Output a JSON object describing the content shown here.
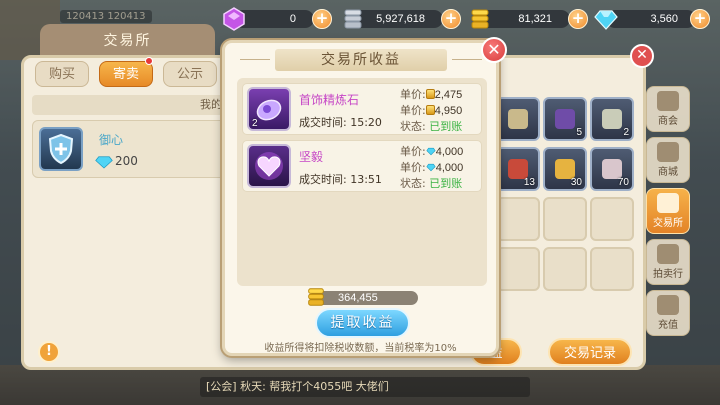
{
  "background": {
    "info_text": "120413 120413",
    "chat_text": "[公会] 秋天: 帮我打个4055吧 大佬们"
  },
  "currency_bar": [
    {
      "icon": "purple-gem-icon",
      "value": "0"
    },
    {
      "icon": "silver-coin-stack-icon",
      "value": "5,927,618"
    },
    {
      "icon": "gold-coin-stack-icon",
      "value": "81,321"
    },
    {
      "icon": "diamond-icon",
      "value": "3,560"
    }
  ],
  "trading_house": {
    "title": "交易所",
    "tabs": [
      {
        "label": "购买",
        "active": false
      },
      {
        "label": "寄卖",
        "active": true,
        "badge": true
      },
      {
        "label": "公示",
        "active": false
      }
    ],
    "list_header": "我的",
    "listing": {
      "name": "御心",
      "price": "200"
    },
    "inventory_counts": [
      "2",
      "5",
      "2",
      "13",
      "30",
      "70"
    ],
    "bottom_buttons": {
      "sell_partial": "益",
      "record": "交易记录"
    },
    "side_menu": [
      {
        "label": "商会",
        "active": false
      },
      {
        "label": "商城",
        "active": false
      },
      {
        "label": "交易所",
        "active": true
      },
      {
        "label": "拍卖行",
        "active": false
      },
      {
        "label": "充值",
        "active": false
      }
    ]
  },
  "modal": {
    "title": "交易所收益",
    "close_label": "✕",
    "records": [
      {
        "name": "首饰精炼石",
        "count": "2",
        "time_label": "成交时间:",
        "time": "15:20",
        "unit_price_label": "单价:",
        "unit_price": "2,475",
        "total_price_label": "单价:",
        "total_price": "4,950",
        "currency": "gold",
        "status_label": "状态:",
        "status": "已到账"
      },
      {
        "name": "坚毅",
        "count": "",
        "time_label": "成交时间:",
        "time": "13:51",
        "unit_price_label": "单价:",
        "unit_price": "4,000",
        "total_price_label": "单价:",
        "total_price": "4,000",
        "currency": "diamond",
        "status_label": "状态:",
        "status": "已到账"
      }
    ],
    "total": "364,455",
    "claim_button": "提取收益",
    "tax_note": "收益所得将扣除税收数额，当前税率为10%"
  },
  "colors": {
    "accent_orange": "#e78a27",
    "claim_blue": "#2e9fe0",
    "item_name_purple": "#c646c6",
    "status_green": "#3bb343",
    "close_red": "#d83b3b"
  }
}
